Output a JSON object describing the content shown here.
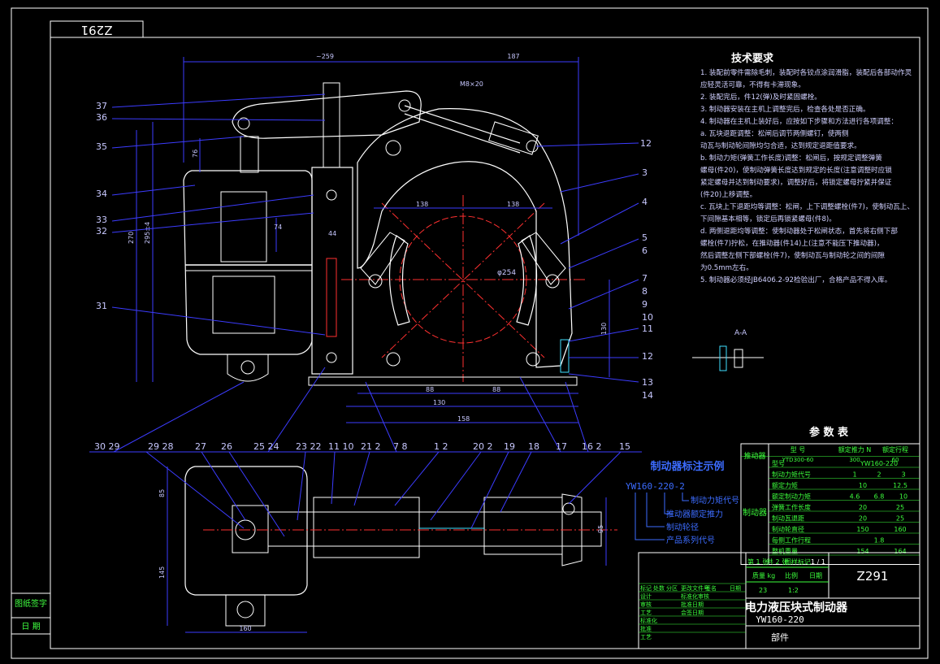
{
  "drawing": {
    "corner_code": "Z291",
    "title_code": "Z291",
    "product_name": "电力液压块式制动器",
    "model": "YW160-220",
    "part_type": "部件"
  },
  "tech_requirements": {
    "title": "技术要求",
    "items": [
      "1. 装配前零件需除毛刺，装配时各铰点涂润滑脂，装配后各部动作灵",
      "   应轻灵活可靠，不得有卡滞现象。",
      "2. 装配完后，件12(弹)及时紧固螺栓。",
      "3. 制动器安装在主机上调整完后，检查各处是否正确。",
      "4. 制动器在主机上装好后，应按如下步骤和方法进行各项调整：",
      "   a. 瓦块退距调整：松闸后调节两侧螺钉，使两侧",
      "      动瓦与制动轮间隙均匀合适，达到规定退距值要求。",
      "   b. 制动力矩(弹簧工作长度)调整：松闸后，按规定调整弹簧",
      "      螺母(件20)，使制动弹簧长度达到规定的长度(注意调整时应锁",
      "      紧定螺母并达到制动要求)，调整好后，将锁定螺母拧紧并保证",
      "      (件20)上移调整。",
      "   c. 瓦块上下退距均等调整：松闸，上下调整螺栓(件7)，使制动瓦上、",
      "      下间隙基本相等，锁定后再锁紧螺母(件8)。",
      "   d. 两侧退距均等调整：使制动器处于松闸状态，首先将右侧下部",
      "      螺栓(件7)拧松，在推动器(件14)上(注意不能压下推动器)，",
      "      然后调整左侧下部螺栓(件7)，使制动瓦与制动轮之间的间隙",
      "      为0.5mm左右。",
      "5. 制动器必须经JB6406.2-92检验出厂，合格产品不得入库。"
    ]
  },
  "params_table": {
    "title": "参 数 表",
    "side_header": "推动器",
    "col_headers": [
      "型  号",
      "额定推力 N",
      "额定行程"
    ],
    "pusher_row": [
      "YTD300-60",
      "300",
      "60"
    ],
    "group_label": "制动器",
    "rows": [
      [
        "型号",
        "YW160-220"
      ],
      [
        "制动力矩代号",
        "1",
        "2",
        "3"
      ],
      [
        "额定力矩",
        "10",
        "12.5"
      ],
      [
        "额定制动力矩",
        "4.6",
        "6.8",
        "10"
      ],
      [
        "弹簧工作长度",
        "20",
        "25"
      ],
      [
        "制动瓦退距",
        "20",
        "25"
      ],
      [
        "制动轮直径",
        "150",
        "160"
      ],
      [
        "每侧工作行程",
        "1.8"
      ],
      [
        "整机重量",
        "154",
        "164"
      ]
    ]
  },
  "notation_example": {
    "title": "制动器标注示例",
    "code": "YW160-220-2",
    "labels": [
      "制动力矩代号",
      "推动器额定推力",
      "制动轮径",
      "产品系列代号"
    ]
  },
  "title_block": {
    "sheet_info": [
      "第 1 张",
      "共 2 张",
      "图样标记",
      "1 / 1"
    ],
    "quantity_label": "质量 kg",
    "scale_label": "比例",
    "date_label": "日期",
    "scale_value": "1:2",
    "weight_value": "23",
    "sign_rows": [
      [
        "标记",
        "处数",
        "分区",
        "更改文件号",
        "签名",
        "日期"
      ],
      [
        "设计",
        "",
        "",
        "标准化审核",
        "",
        ""
      ],
      [
        "审核",
        "",
        "",
        "批准日期",
        "",
        ""
      ],
      [
        "工艺",
        "",
        "",
        "会签日期",
        "",
        ""
      ],
      [
        "标准化",
        "",
        "",
        "",
        "",
        ""
      ],
      [
        "批准",
        "",
        "",
        "",
        "",
        ""
      ],
      [
        "工艺",
        "",
        "",
        "",
        "",
        ""
      ]
    ]
  },
  "side_stamp": {
    "line1": "图纸签字",
    "line2": "日  期"
  },
  "dimensions": {
    "top_left": "~259",
    "top_right": "187",
    "hole": "M8×20",
    "d_wheel": "φ254",
    "v1": "270",
    "v2": "295±4",
    "v3": "76",
    "v4": "74",
    "v5": "44",
    "h1": "138",
    "h2": "138",
    "h3": "88",
    "h4": "88",
    "h5": "130",
    "h6": "158",
    "r1": "130",
    "section": "A-A",
    "plan_w": "160",
    "plan_h1": "85",
    "plan_h2": "145",
    "plan_r": "95"
  },
  "balloons_right": [
    "12",
    "3",
    "4",
    "5",
    "6",
    "7",
    "8",
    "9",
    "10",
    "11",
    "12",
    "13",
    "14"
  ],
  "balloons_left": [
    "37",
    "36",
    "35",
    "34",
    "33",
    "32",
    "31"
  ],
  "bottom_labels": [
    "30 29",
    "29 28",
    "27",
    "26",
    "25 24",
    "23 22",
    "11 10",
    "21 2",
    "7 8",
    "1 2",
    "20 2",
    "19",
    "18",
    "17",
    "16 2",
    "15"
  ],
  "colors": {
    "background": "#000000",
    "frame": "#ffffff",
    "part": "#ffffff",
    "dim": "#3c3cff",
    "center": "#ff3030",
    "text_dim": "#c8c8ff",
    "note_text": "#d0d0ff",
    "table_green": "#3cff3c",
    "cyan": "#40e0ff",
    "yellow": "#ffff40"
  }
}
